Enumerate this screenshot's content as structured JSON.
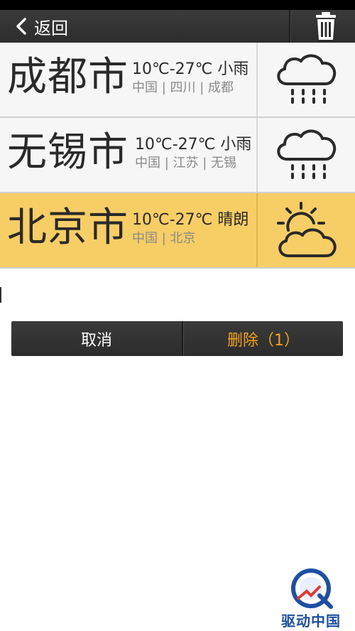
{
  "header": {
    "back_label": "返回"
  },
  "cities": [
    {
      "name": "成都市",
      "temp": "10℃-27℃ 小雨",
      "region": "中国 | 四川 | 成都",
      "weather_icon": "rain-cloud-icon",
      "selected": false
    },
    {
      "name": "无锡市",
      "temp": "10℃-27℃ 小雨",
      "region": "中国 | 江苏 | 无锡",
      "weather_icon": "rain-cloud-icon",
      "selected": false
    },
    {
      "name": "北京市",
      "temp": "10℃-27℃ 晴朗",
      "region": "中国 | 北京",
      "weather_icon": "sun-cloud-icon",
      "selected": true
    }
  ],
  "actions": {
    "cancel_label": "取消",
    "delete_label": "删除（1）"
  },
  "watermark": {
    "text": "驱动中国"
  },
  "colors": {
    "selected_row": "#f7ce66",
    "delete_accent": "#f2a21a",
    "bar_dark": "#333333"
  }
}
